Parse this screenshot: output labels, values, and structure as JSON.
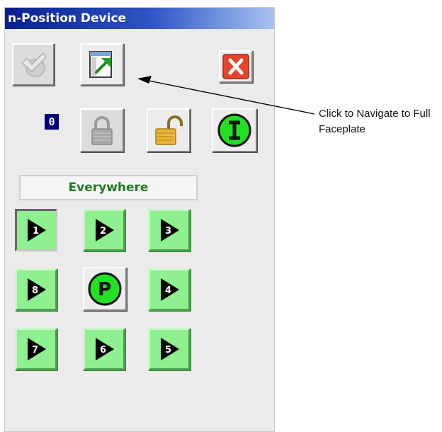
{
  "window": {
    "title": "n-Position Device"
  },
  "counter": {
    "value": "0"
  },
  "mode": {
    "label": "Everywhere"
  },
  "positions": [
    {
      "number": "1",
      "active": true
    },
    {
      "number": "2"
    },
    {
      "number": "3"
    },
    {
      "number": "8"
    },
    {
      "number": "P",
      "type": "park"
    },
    {
      "number": "4"
    },
    {
      "number": "7"
    },
    {
      "number": "6"
    },
    {
      "number": "5"
    }
  ],
  "annotation": {
    "text": "Click to Navigate to Full Faceplate"
  },
  "icons": {
    "acknowledge": "acknowledge-icon",
    "navigate": "navigate-to-faceplate-icon",
    "close": "close-icon",
    "lock": "lock-icon",
    "unlock": "unlock-icon",
    "interlock": "interlock-icon"
  },
  "colors": {
    "titlebar": "#0a1f8f",
    "position_button": "#8ef08e",
    "mode_text": "#1f7a1f",
    "counter_bg": "#000080",
    "close_button": "#e2452c"
  }
}
